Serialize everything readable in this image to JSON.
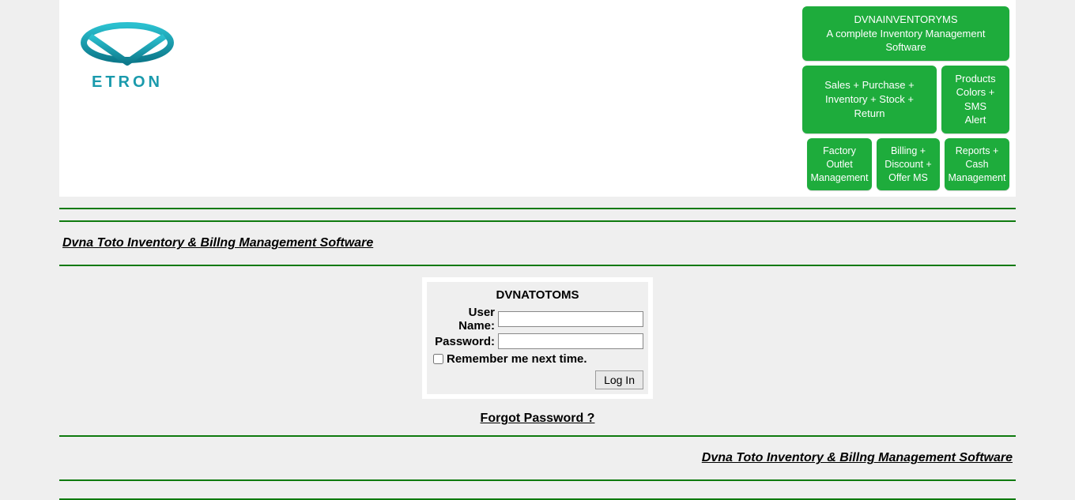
{
  "header": {
    "logo_text": "ETRON",
    "badges": {
      "row1": {
        "wide": {
          "line1": "DVNAINVENTORYMS",
          "line2": "A complete Inventory Management Software"
        }
      },
      "row2": {
        "left": {
          "line1": "Sales + Purchase  +",
          "line2": "Inventory + Stock + Return"
        },
        "right": {
          "line1": "Products",
          "line2": "Colors + SMS",
          "line3": "Alert"
        }
      },
      "row3": {
        "a": {
          "line1": "Factory",
          "line2": "Outlet",
          "line3": "Management"
        },
        "b": {
          "line1": "Billing +",
          "line2": "Discount +",
          "line3": "Offer MS"
        },
        "c": {
          "line1": "Reports +",
          "line2": "Cash",
          "line3": "Management"
        }
      }
    }
  },
  "titles": {
    "top": "Dvna Toto Inventory & Billng Management Software",
    "bottom": "Dvna Toto Inventory & Billng Management Software"
  },
  "login": {
    "title": "DVNATOTOMS",
    "username_label": "User Name:",
    "password_label": "Password:",
    "username_value": "",
    "password_value": "",
    "remember_label": "Remember me next time.",
    "submit_label": "Log In",
    "forgot_label": "Forgot Password ?"
  }
}
